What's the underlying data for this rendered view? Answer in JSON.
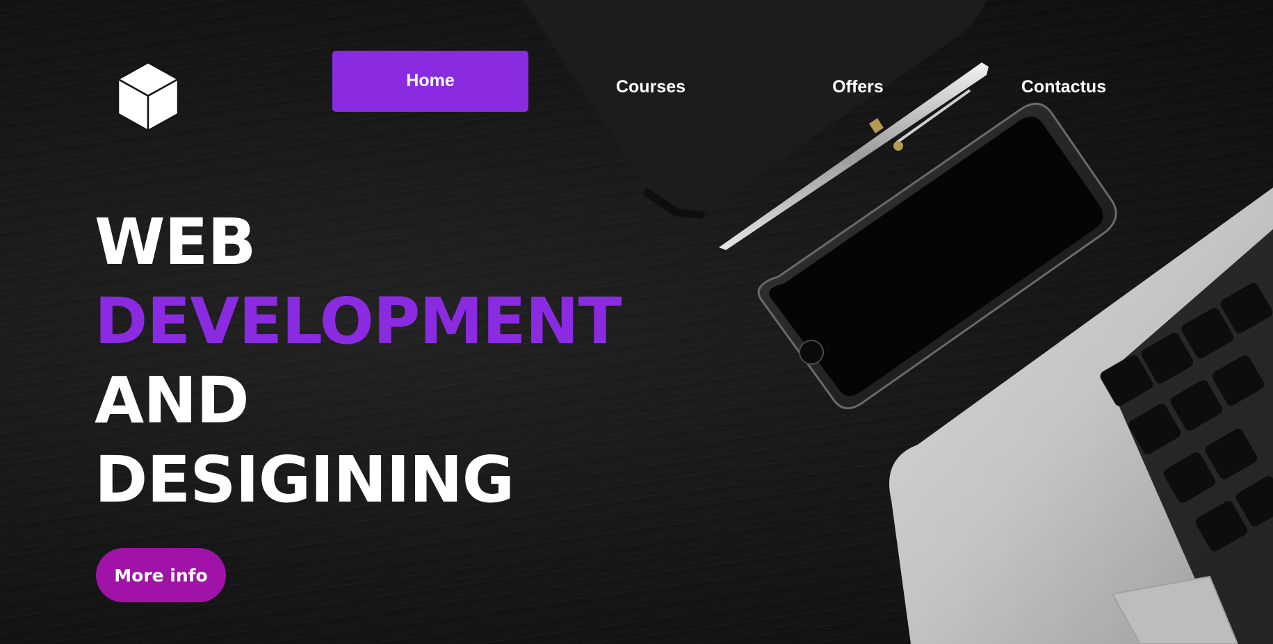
{
  "nav": {
    "items": [
      {
        "label": "Home",
        "active": true
      },
      {
        "label": "Courses",
        "active": false
      },
      {
        "label": "Offers",
        "active": false
      },
      {
        "label": "Contactus",
        "active": false
      }
    ]
  },
  "hero": {
    "line1": "WEB",
    "line2": "DEVELOPMENT",
    "line3": "AND",
    "line4": "DESIGINING",
    "cta_label": "More info"
  },
  "icons": {
    "logo": "cube-icon"
  },
  "colors": {
    "accent": "#8a2be2",
    "cta": "#a112a8",
    "background": "#141414",
    "text": "#ffffff"
  }
}
